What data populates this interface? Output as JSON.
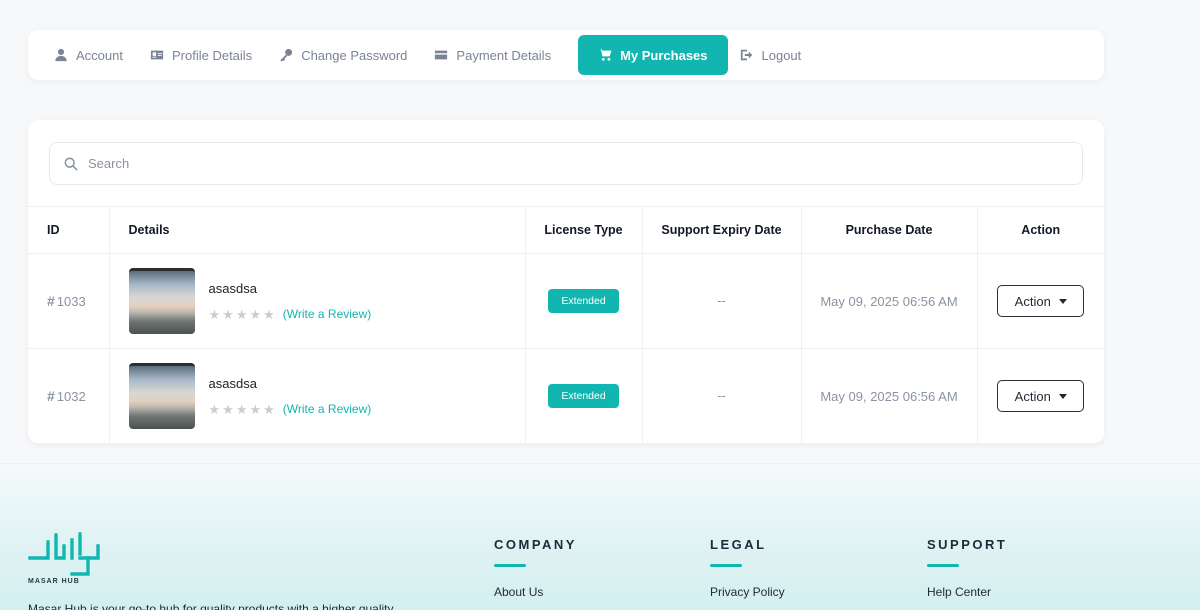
{
  "tabs": [
    {
      "label": "Account",
      "icon": "user-icon",
      "active": false
    },
    {
      "label": "Profile Details",
      "icon": "id-card-icon",
      "active": false
    },
    {
      "label": "Change Password",
      "icon": "key-icon",
      "active": false
    },
    {
      "label": "Payment Details",
      "icon": "credit-card-icon",
      "active": false
    },
    {
      "label": "My Purchases",
      "icon": "cart-icon",
      "active": true
    },
    {
      "label": "Logout",
      "icon": "logout-icon",
      "active": false
    }
  ],
  "search": {
    "placeholder": "Search"
  },
  "table": {
    "headers": [
      "ID",
      "Details",
      "License Type",
      "Support Expiry Date",
      "Purchase Date",
      "Action"
    ],
    "rows": [
      {
        "id_prefix": "#",
        "id": "1033",
        "title": "asasdsa",
        "review_label": "(Write a Review)",
        "rating": 0,
        "license": "Extended",
        "support_expiry": "--",
        "purchase_date": "May 09, 2025 06:56 AM",
        "action_label": "Action"
      },
      {
        "id_prefix": "#",
        "id": "1032",
        "title": "asasdsa",
        "review_label": "(Write a Review)",
        "rating": 0,
        "license": "Extended",
        "support_expiry": "--",
        "purchase_date": "May 09, 2025 06:56 AM",
        "action_label": "Action"
      }
    ]
  },
  "footer": {
    "logo_text": "MASAR HUB",
    "tagline_fragment": "Masar Hub is your go-to hub for quality products with a higher quality",
    "columns": [
      {
        "heading": "COMPANY",
        "links": [
          "About Us"
        ]
      },
      {
        "heading": "LEGAL",
        "links": [
          "Privacy Policy"
        ]
      },
      {
        "heading": "SUPPORT",
        "links": [
          "Help Center"
        ]
      }
    ]
  },
  "colors": {
    "accent": "#12b6b0",
    "muted_text": "#8a93a2",
    "border": "#eef0f3"
  }
}
